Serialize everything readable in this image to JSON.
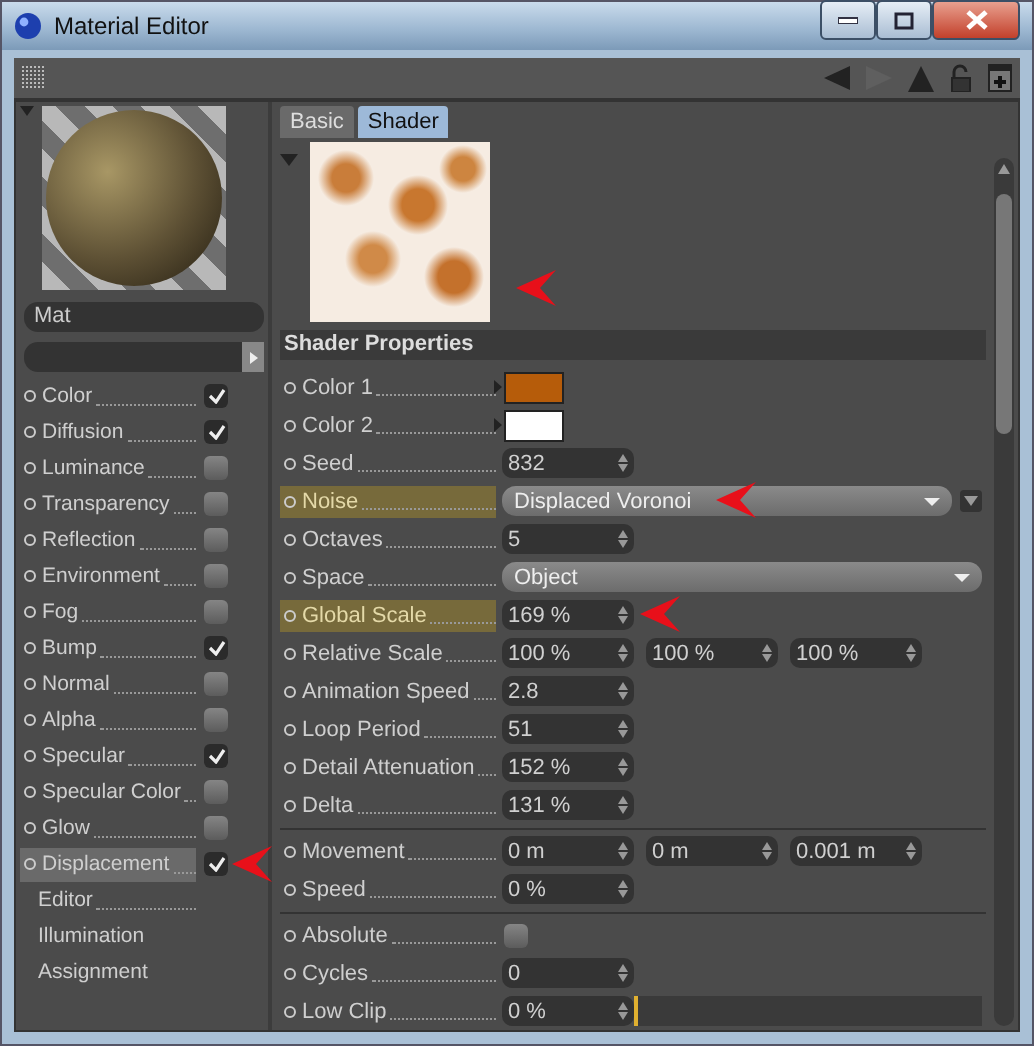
{
  "window": {
    "title": "Material Editor"
  },
  "material": {
    "name": "Mat"
  },
  "channels": [
    {
      "kind": "channel",
      "label": "Color",
      "checked": true,
      "selected": false,
      "marked": false
    },
    {
      "kind": "channel",
      "label": "Diffusion",
      "checked": true,
      "selected": false,
      "marked": false
    },
    {
      "kind": "channel",
      "label": "Luminance",
      "checked": false,
      "selected": false,
      "marked": false
    },
    {
      "kind": "channel",
      "label": "Transparency",
      "checked": false,
      "selected": false,
      "marked": false
    },
    {
      "kind": "channel",
      "label": "Reflection",
      "checked": false,
      "selected": false,
      "marked": false
    },
    {
      "kind": "channel",
      "label": "Environment",
      "checked": false,
      "selected": false,
      "marked": false
    },
    {
      "kind": "channel",
      "label": "Fog",
      "checked": false,
      "selected": false,
      "marked": false
    },
    {
      "kind": "channel",
      "label": "Bump",
      "checked": true,
      "selected": false,
      "marked": false
    },
    {
      "kind": "channel",
      "label": "Normal",
      "checked": false,
      "selected": false,
      "marked": false
    },
    {
      "kind": "channel",
      "label": "Alpha",
      "checked": false,
      "selected": false,
      "marked": false
    },
    {
      "kind": "channel",
      "label": "Specular",
      "checked": true,
      "selected": false,
      "marked": false
    },
    {
      "kind": "channel",
      "label": "Specular Color",
      "checked": false,
      "selected": false,
      "marked": false
    },
    {
      "kind": "channel",
      "label": "Glow",
      "checked": false,
      "selected": false,
      "marked": false
    },
    {
      "kind": "channel",
      "label": "Displacement",
      "checked": true,
      "selected": true,
      "marked": true
    },
    {
      "kind": "page",
      "label": "Editor",
      "selected": false
    },
    {
      "kind": "page",
      "label": "Illumination",
      "selected": false
    },
    {
      "kind": "page",
      "label": "Assignment",
      "selected": false
    }
  ],
  "tabs": [
    {
      "label": "Basic",
      "selected": false
    },
    {
      "label": "Shader",
      "selected": true
    }
  ],
  "preview": {
    "marked": true
  },
  "section": {
    "title": "Shader Properties"
  },
  "groups": [
    [
      {
        "kind": "color",
        "label": "Color 1",
        "color": "#b65c0a"
      },
      {
        "kind": "color",
        "label": "Color 2",
        "color": "#ffffff"
      },
      {
        "kind": "number",
        "label": "Seed",
        "values": [
          "832"
        ]
      },
      {
        "kind": "dropdown",
        "label": "Noise",
        "value": "Displaced Voronoi",
        "highlighted": true,
        "menu_button": true,
        "marked": true
      },
      {
        "kind": "number",
        "label": "Octaves",
        "values": [
          "5"
        ]
      },
      {
        "kind": "dropdown",
        "label": "Space",
        "value": "Object"
      },
      {
        "kind": "number",
        "label": "Global Scale",
        "values": [
          "169 %"
        ],
        "highlighted": true,
        "marked": true
      },
      {
        "kind": "number",
        "label": "Relative Scale",
        "values": [
          "100 %",
          "100 %",
          "100 %"
        ]
      },
      {
        "kind": "number",
        "label": "Animation Speed",
        "values": [
          "2.8"
        ]
      },
      {
        "kind": "number",
        "label": "Loop Period",
        "values": [
          "51"
        ]
      },
      {
        "kind": "number",
        "label": "Detail Attenuation",
        "values": [
          "152 %"
        ]
      },
      {
        "kind": "number",
        "label": "Delta",
        "values": [
          "131 %"
        ]
      }
    ],
    [
      {
        "kind": "number",
        "label": "Movement",
        "values": [
          "0 m",
          "0 m",
          "0.001 m"
        ]
      },
      {
        "kind": "number",
        "label": "Speed",
        "values": [
          "0 %"
        ]
      }
    ],
    [
      {
        "kind": "checkbox",
        "label": "Absolute",
        "checked": false
      },
      {
        "kind": "number",
        "label": "Cycles",
        "values": [
          "0"
        ]
      },
      {
        "kind": "slider",
        "label": "Low Clip",
        "values": [
          "0 %"
        ],
        "level": 0
      }
    ]
  ]
}
